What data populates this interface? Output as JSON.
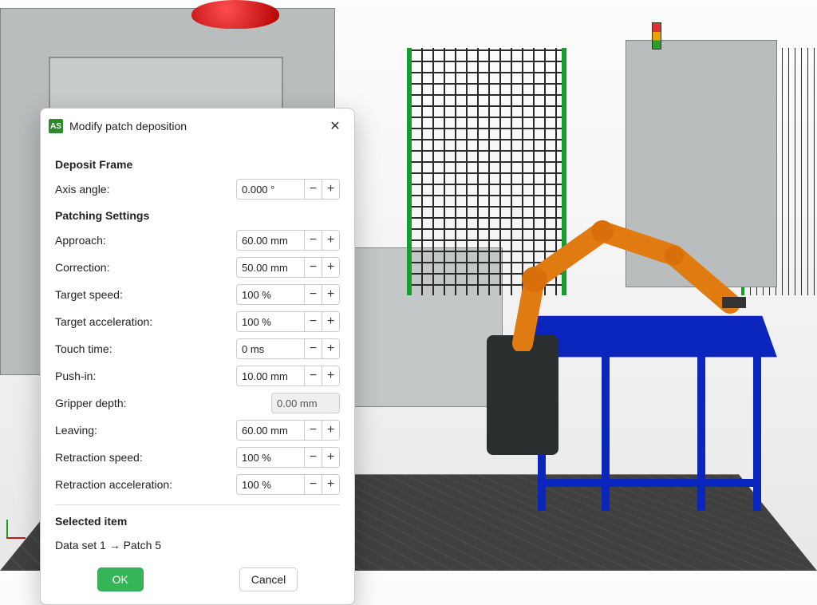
{
  "dialog": {
    "app_icon_text": "AS",
    "title": "Modify patch deposition",
    "sections": {
      "deposit_frame": {
        "heading": "Deposit Frame",
        "axis_angle": {
          "label": "Axis angle:",
          "value": "0.000 °"
        }
      },
      "patching": {
        "heading": "Patching Settings",
        "approach": {
          "label": "Approach:",
          "value": "60.00 mm"
        },
        "correction": {
          "label": "Correction:",
          "value": "50.00 mm"
        },
        "target_speed": {
          "label": "Target speed:",
          "value": "100 %"
        },
        "target_accel": {
          "label": "Target acceleration:",
          "value": "100 %"
        },
        "touch_time": {
          "label": "Touch time:",
          "value": "0 ms"
        },
        "push_in": {
          "label": "Push-in:",
          "value": "10.00 mm"
        },
        "gripper_depth": {
          "label": "Gripper depth:",
          "value": "0.00 mm",
          "readonly": true
        },
        "leaving": {
          "label": "Leaving:",
          "value": "60.00 mm"
        },
        "retraction_speed": {
          "label": "Retraction speed:",
          "value": "100 %"
        },
        "retraction_accel": {
          "label": "Retraction acceleration:",
          "value": "100 %"
        }
      },
      "selected": {
        "heading": "Selected item",
        "text": "Data set 1 → Patch 5"
      }
    },
    "buttons": {
      "ok": "OK",
      "cancel": "Cancel"
    }
  }
}
